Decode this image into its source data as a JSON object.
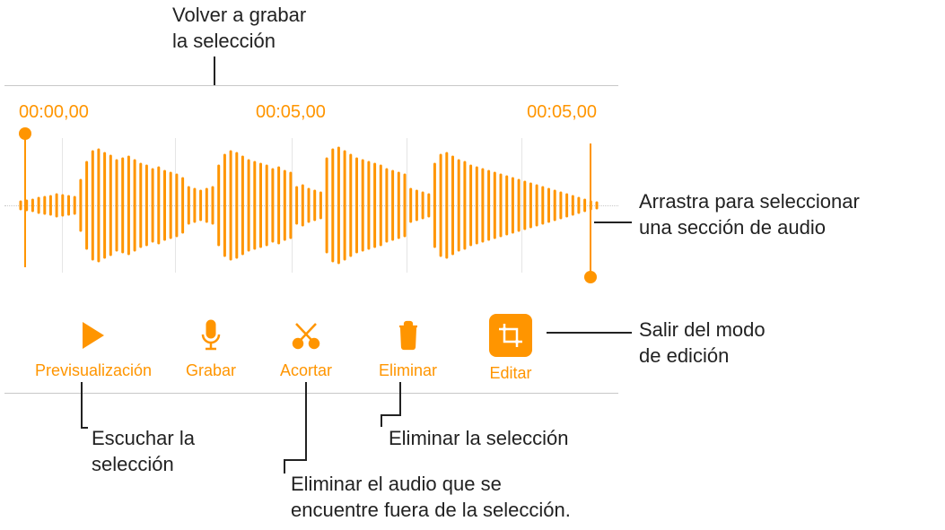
{
  "callouts": {
    "rerecord": "Volver a grabar\nla selección",
    "drag": "Arrastra para seleccionar\nuna sección de audio",
    "exit_edit": "Salir del modo\nde edición",
    "listen": "Escuchar la\nselección",
    "trim_outside": "Eliminar el audio que se\nencuentre fuera de la selección.",
    "delete_sel": "Eliminar la selección"
  },
  "timeline": {
    "start": "00:00,00",
    "mid": "00:05,00",
    "end": "00:05,00"
  },
  "toolbar": {
    "preview": "Previsualización",
    "record": "Grabar",
    "trim": "Acortar",
    "delete": "Eliminar",
    "edit": "Editar"
  },
  "colors": {
    "accent": "#ff9500"
  },
  "icons": {
    "play": "play-icon",
    "mic": "mic-icon",
    "scissors": "scissors-icon",
    "trash": "trash-icon",
    "crop": "crop-icon"
  }
}
